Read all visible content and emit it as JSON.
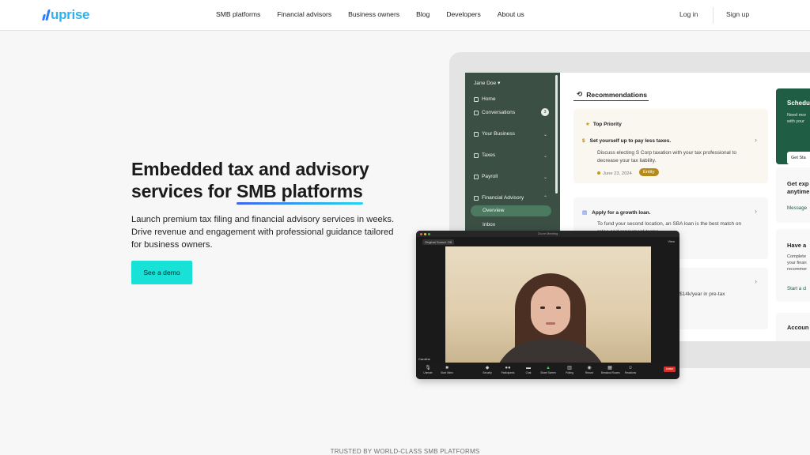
{
  "header": {
    "logo_text": "uprise",
    "nav": [
      "SMB platforms",
      "Financial advisors",
      "Business owners",
      "Blog",
      "Developers",
      "About us"
    ],
    "login": "Log in",
    "signup": "Sign up"
  },
  "hero": {
    "title_line1": "Embedded tax and advisory",
    "title_line2_pre": "services for ",
    "title_highlight": "SMB platforms",
    "description": "Launch premium tax filing and financial advisory services in weeks. Drive revenue and engagement with professional guidance tailored for business owners.",
    "cta": "See a demo"
  },
  "trusted_text": "TRUSTED BY WORLD-CLASS SMB PLATFORMS",
  "dashboard": {
    "user": "Jane Doe",
    "sidebar": {
      "home": "Home",
      "conversations": "Conversations",
      "conversations_badge": "3",
      "your_business": "Your Business",
      "taxes": "Taxes",
      "payroll": "Payroll",
      "financial_advisory": "Financial Advisory",
      "overview": "Overview",
      "inbox": "Inbox"
    },
    "recommendations_title": "Recommendations",
    "card1": {
      "priority": "Top Priority",
      "heading": "Set yourself up to pay less taxes.",
      "body": "Discuss electing S Corp taxation with your tax professional to decrease your tax liability.",
      "date": "June 23, 2024",
      "tag": "Entity"
    },
    "card2": {
      "heading": "Apply for a growth loan.",
      "body": "To fund your second location, an SBA loan is the best match on rates and repayment terms."
    },
    "card3": {
      "body": "$14k/year in pre-tax"
    },
    "right": {
      "schedule_title": "Schedu",
      "schedule_sub1": "Need mor",
      "schedule_sub2": "with your",
      "schedule_btn": "Get Sta",
      "expert_title1": "Get exp",
      "expert_title2": "anytime",
      "expert_link": "Message",
      "have_title": "Have a",
      "have_sub1": "Complete",
      "have_sub2": "your finan",
      "have_sub3": "recommer",
      "have_link": "Start a cl",
      "account_title": "Accoun"
    }
  },
  "video": {
    "window_title": "Zoom Meeting",
    "tag": "Original Sound: Off",
    "view": "View",
    "name": "Caroline",
    "controls": [
      "Unmute",
      "Start Video",
      "Security",
      "Participants",
      "Chat",
      "Share Screen",
      "Polling",
      "Record",
      "Breakout Rooms",
      "Reactions"
    ],
    "leave": "Leave"
  },
  "colors": {
    "accent_cta": "#18e1d8",
    "brand_blue": "#2db4f0",
    "sidebar_green": "#3b4f45",
    "highlight_gradient": [
      "#3e64f2",
      "#26d6f0"
    ]
  }
}
